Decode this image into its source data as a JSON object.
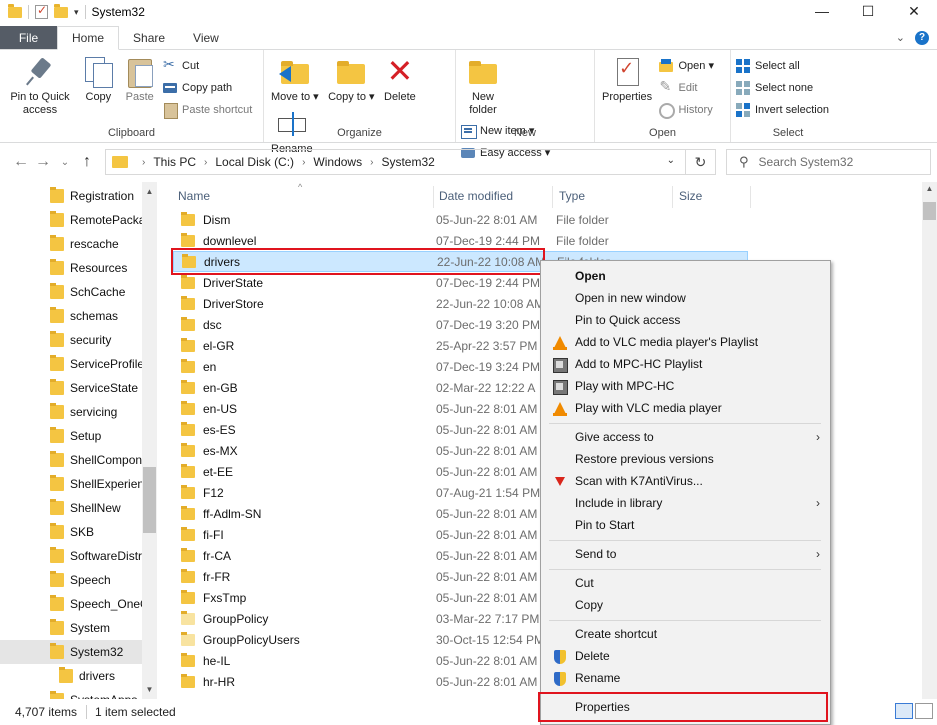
{
  "window": {
    "title": "System32",
    "controls": [
      "—",
      "☐",
      "✕"
    ]
  },
  "ribbon_tabs": {
    "file": "File",
    "home": "Home",
    "share": "Share",
    "view": "View"
  },
  "ribbon": {
    "clipboard": {
      "label": "Clipboard",
      "pin": "Pin to Quick access",
      "copy": "Copy",
      "paste": "Paste",
      "cut": "Cut",
      "copy_path": "Copy path",
      "paste_shortcut": "Paste shortcut"
    },
    "organize": {
      "label": "Organize",
      "move_to": "Move to ▾",
      "copy_to": "Copy to ▾",
      "delete": "Delete",
      "rename": "Rename"
    },
    "new": {
      "label": "New",
      "new_folder": "New folder",
      "new_item": "New item ▾",
      "easy_access": "Easy access ▾"
    },
    "open": {
      "label": "Open",
      "properties": "Properties",
      "open": "Open ▾",
      "edit": "Edit",
      "history": "History"
    },
    "select": {
      "label": "Select",
      "select_all": "Select all",
      "select_none": "Select none",
      "invert": "Invert selection"
    }
  },
  "address": {
    "crumbs": [
      "This PC",
      "Local Disk (C:)",
      "Windows",
      "System32"
    ],
    "search_placeholder": "Search System32"
  },
  "nav": {
    "items": [
      "Registration",
      "RemotePacka",
      "rescache",
      "Resources",
      "SchCache",
      "schemas",
      "security",
      "ServiceProfile",
      "ServiceState",
      "servicing",
      "Setup",
      "ShellCompon",
      "ShellExperien",
      "ShellNew",
      "SKB",
      "SoftwareDistr",
      "Speech",
      "Speech_OneC",
      "System",
      "System32",
      "drivers",
      "SystemApps"
    ]
  },
  "columns": {
    "name": "Name",
    "date": "Date modified",
    "type": "Type",
    "size": "Size"
  },
  "files": [
    {
      "name": "Dism",
      "date": "05-Jun-22 8:01 AM",
      "type": "File folder"
    },
    {
      "name": "downlevel",
      "date": "07-Dec-19 2:44 PM",
      "type": "File folder"
    },
    {
      "name": "drivers",
      "date": "22-Jun-22 10:08 AM",
      "type": "File folder"
    },
    {
      "name": "DriverState",
      "date": "07-Dec-19 2:44 PM",
      "type": ""
    },
    {
      "name": "DriverStore",
      "date": "22-Jun-22 10:08 AM",
      "type": ""
    },
    {
      "name": "dsc",
      "date": "07-Dec-19 3:20 PM",
      "type": ""
    },
    {
      "name": "el-GR",
      "date": "25-Apr-22 3:57 PM",
      "type": ""
    },
    {
      "name": "en",
      "date": "07-Dec-19 3:24 PM",
      "type": ""
    },
    {
      "name": "en-GB",
      "date": "02-Mar-22 12:22 A",
      "type": ""
    },
    {
      "name": "en-US",
      "date": "05-Jun-22 8:01 AM",
      "type": ""
    },
    {
      "name": "es-ES",
      "date": "05-Jun-22 8:01 AM",
      "type": ""
    },
    {
      "name": "es-MX",
      "date": "05-Jun-22 8:01 AM",
      "type": ""
    },
    {
      "name": "et-EE",
      "date": "05-Jun-22 8:01 AM",
      "type": ""
    },
    {
      "name": "F12",
      "date": "07-Aug-21 1:54 PM",
      "type": ""
    },
    {
      "name": "ff-Adlm-SN",
      "date": "05-Jun-22 8:01 AM",
      "type": ""
    },
    {
      "name": "fi-FI",
      "date": "05-Jun-22 8:01 AM",
      "type": ""
    },
    {
      "name": "fr-CA",
      "date": "05-Jun-22 8:01 AM",
      "type": ""
    },
    {
      "name": "fr-FR",
      "date": "05-Jun-22 8:01 AM",
      "type": ""
    },
    {
      "name": "FxsTmp",
      "date": "05-Jun-22 8:01 AM",
      "type": ""
    },
    {
      "name": "GroupPolicy",
      "date": "03-Mar-22 7:17 PM",
      "type": ""
    },
    {
      "name": "GroupPolicyUsers",
      "date": "30-Oct-15 12:54 PM",
      "type": ""
    },
    {
      "name": "he-IL",
      "date": "05-Jun-22 8:01 AM",
      "type": ""
    },
    {
      "name": "hr-HR",
      "date": "05-Jun-22 8:01 AM",
      "type": ""
    }
  ],
  "context_menu": {
    "open": "Open",
    "open_new_window": "Open in new window",
    "pin_quick": "Pin to Quick access",
    "vlc_playlist": "Add to VLC media player's Playlist",
    "mpc_playlist": "Add to MPC-HC Playlist",
    "play_mpc": "Play with MPC-HC",
    "play_vlc": "Play with VLC media player",
    "give_access": "Give access to",
    "restore": "Restore previous versions",
    "scan_k7": "Scan with K7AntiVirus...",
    "include_library": "Include in library",
    "pin_start": "Pin to Start",
    "send_to": "Send to",
    "cut": "Cut",
    "copy": "Copy",
    "create_shortcut": "Create shortcut",
    "delete": "Delete",
    "rename": "Rename",
    "properties": "Properties"
  },
  "status": {
    "items": "4,707 items",
    "selected": "1 item selected"
  }
}
